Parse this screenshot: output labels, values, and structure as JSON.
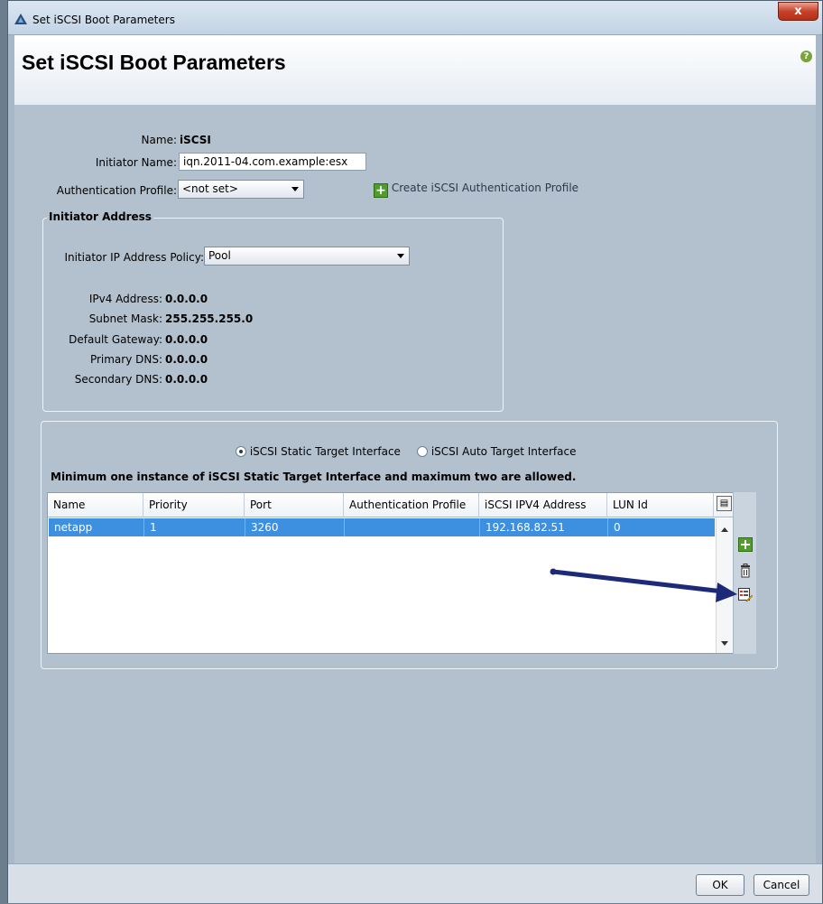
{
  "window": {
    "title": "Set iSCSI Boot Parameters",
    "close_label": "x"
  },
  "header": {
    "title": "Set iSCSI Boot Parameters",
    "help_icon": "help-icon"
  },
  "form": {
    "name_label": "Name:",
    "name_value": "iSCSI",
    "initiator_name_label": "Initiator Name:",
    "initiator_name_value": "iqn.2011-04.com.example:esx",
    "auth_profile_label": "Authentication Profile:",
    "auth_profile_value": "<not set>",
    "create_auth_link": "Create iSCSI Authentication Profile"
  },
  "initiator_address": {
    "legend": "Initiator Address",
    "ip_policy_label": "Initiator IP Address Policy:",
    "ip_policy_value": "Pool",
    "ipv4_label": "IPv4 Address:",
    "ipv4_value": "0.0.0.0",
    "subnet_label": "Subnet Mask:",
    "subnet_value": "255.255.255.0",
    "gateway_label": "Default Gateway:",
    "gateway_value": "0.0.0.0",
    "primary_dns_label": "Primary DNS:",
    "primary_dns_value": "0.0.0.0",
    "secondary_dns_label": "Secondary DNS:",
    "secondary_dns_value": "0.0.0.0"
  },
  "target": {
    "static_radio": "iSCSI Static Target Interface",
    "auto_radio": "iSCSI Auto Target Interface",
    "note": "Minimum one instance of iSCSI Static Target Interface and maximum two are allowed.",
    "columns": [
      "Name",
      "Priority",
      "Port",
      "Authentication Profile",
      "iSCSI IPV4 Address",
      "LUN Id"
    ],
    "rows": [
      {
        "name": "netapp",
        "priority": "1",
        "port": "3260",
        "auth_profile": "",
        "ipv4": "192.168.82.51",
        "lun_id": "0"
      }
    ]
  },
  "footer": {
    "ok_label": "OK",
    "cancel_label": "Cancel"
  },
  "colors": {
    "selection": "#3d8fe0",
    "arrow": "#1c2a78",
    "add_icon": "#4f9d2a"
  }
}
